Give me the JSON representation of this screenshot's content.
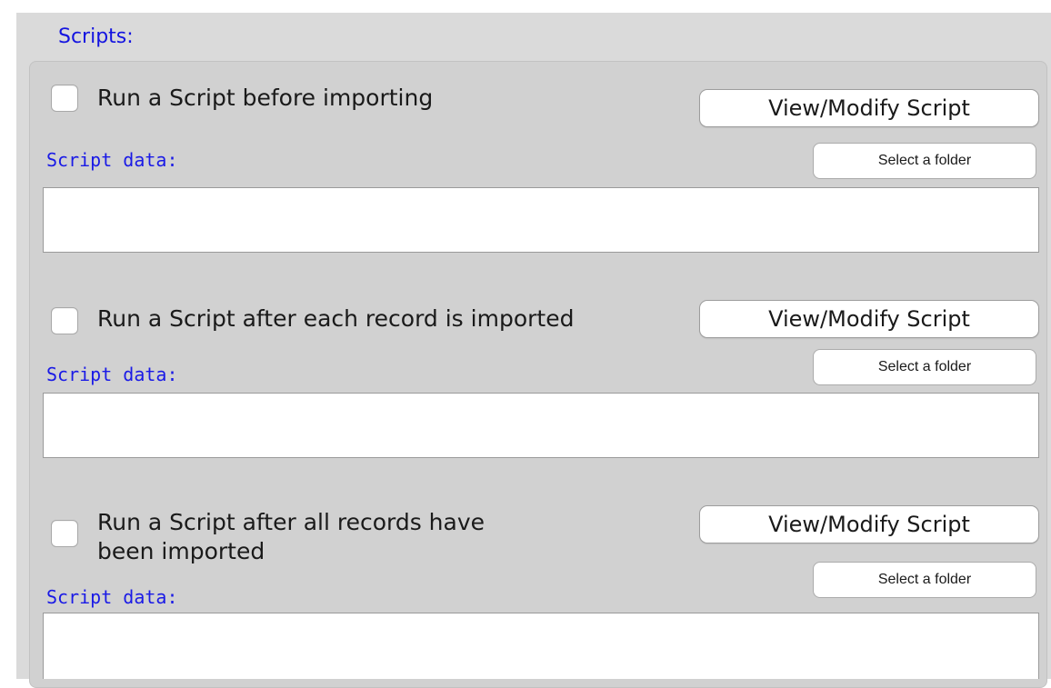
{
  "section": {
    "title": "Scripts:"
  },
  "scripts": [
    {
      "checkbox_label": "Run a Script before importing",
      "checked": false,
      "view_modify_label": "View/Modify Script",
      "select_folder_label": "Select a folder",
      "data_label": "Script data:",
      "data_value": ""
    },
    {
      "checkbox_label": "Run a Script after each record is imported",
      "checked": false,
      "view_modify_label": "View/Modify Script",
      "select_folder_label": "Select a folder",
      "data_label": "Script data:",
      "data_value": ""
    },
    {
      "checkbox_label_line1": "Run a Script after all records have",
      "checkbox_label_line2": "been imported",
      "checked": false,
      "view_modify_label": "View/Modify Script",
      "select_folder_label": "Select a folder",
      "data_label": "Script data:",
      "data_value": ""
    }
  ],
  "colors": {
    "accent_text": "#1414e0",
    "panel_bg": "#d1d1d1",
    "window_bg": "#dadada"
  }
}
